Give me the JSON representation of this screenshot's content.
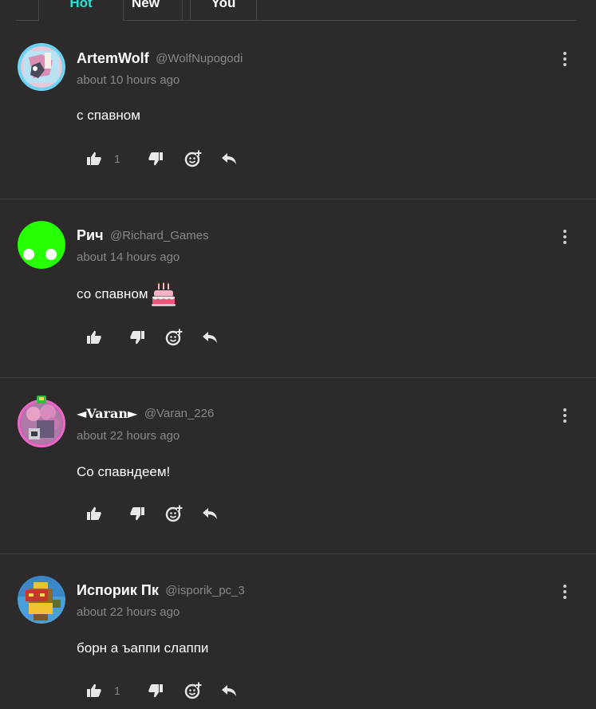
{
  "tabs": {
    "hot": "Hot",
    "new": "New",
    "you": "You"
  },
  "comments": [
    {
      "name": "ArtemWolf",
      "handle": "@WolfNupogodi",
      "time": "about 10 hours ago",
      "text": "с спавном",
      "likes": "1"
    },
    {
      "name": "Рич",
      "handle": "@Richard_Games",
      "time": "about 14 hours ago",
      "text": "со спавном",
      "likes": ""
    },
    {
      "name": "◄Varan►",
      "handle": "@Varan_226",
      "time": "about 22 hours ago",
      "text": "Со спавндеем!",
      "likes": ""
    },
    {
      "name": "Испорик Пк",
      "handle": "@isporik_pc_3",
      "time": "about 22 hours ago",
      "text": "борн а ъаппи слаппи",
      "likes": "1"
    }
  ],
  "icons": {
    "like": "thumbs-up-icon",
    "dislike": "thumbs-down-icon",
    "react": "add-reaction-icon",
    "reply": "reply-icon",
    "menu": "more-vertical-icon",
    "emoji": "birthday-cake-emoji"
  },
  "colors": {
    "background": "#2d2a2b",
    "active_tab": "#2be0d3",
    "muted_text": "#8a8788",
    "divider": "#403c3d"
  }
}
